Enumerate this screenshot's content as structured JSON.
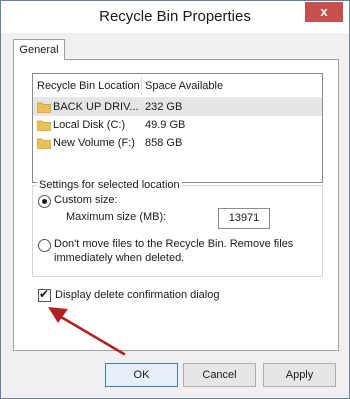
{
  "window": {
    "title": "Recycle Bin Properties",
    "close_label": "x"
  },
  "tabs": [
    {
      "label": "General"
    }
  ],
  "list": {
    "headers": {
      "location": "Recycle Bin Location",
      "space": "Space Available"
    },
    "rows": [
      {
        "name": "BACK UP DRIV...",
        "space": "232 GB"
      },
      {
        "name": "Local Disk (C:)",
        "space": "49.9 GB"
      },
      {
        "name": "New Volume (F:)",
        "space": "858 GB"
      }
    ]
  },
  "settings": {
    "group_title": "Settings for selected location",
    "custom_size_label": "Custom size:",
    "max_size_label": "Maximum size (MB):",
    "max_size_value": "13971",
    "dont_move_line1": "Don't move files to the Recycle Bin. Remove files",
    "dont_move_line2": "immediately when deleted."
  },
  "confirm": {
    "label": "Display delete confirmation dialog",
    "checked": true
  },
  "buttons": {
    "ok": "OK",
    "cancel": "Cancel",
    "apply": "Apply"
  },
  "colors": {
    "folder": "#e8c15a",
    "annotation_arrow": "#b22222",
    "close_button": "#c7504c"
  }
}
